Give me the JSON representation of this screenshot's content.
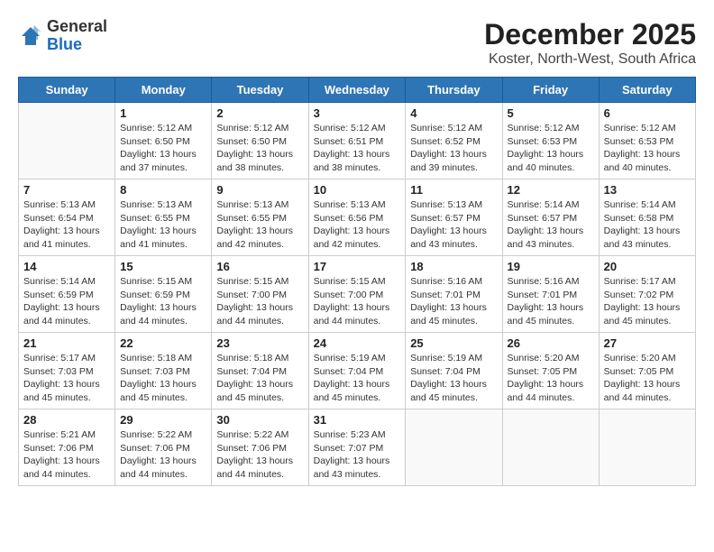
{
  "header": {
    "logo_general": "General",
    "logo_blue": "Blue",
    "title": "December 2025",
    "subtitle": "Koster, North-West, South Africa"
  },
  "days_of_week": [
    "Sunday",
    "Monday",
    "Tuesday",
    "Wednesday",
    "Thursday",
    "Friday",
    "Saturday"
  ],
  "weeks": [
    [
      {
        "day": "",
        "info": ""
      },
      {
        "day": "1",
        "info": "Sunrise: 5:12 AM\nSunset: 6:50 PM\nDaylight: 13 hours\nand 37 minutes."
      },
      {
        "day": "2",
        "info": "Sunrise: 5:12 AM\nSunset: 6:50 PM\nDaylight: 13 hours\nand 38 minutes."
      },
      {
        "day": "3",
        "info": "Sunrise: 5:12 AM\nSunset: 6:51 PM\nDaylight: 13 hours\nand 38 minutes."
      },
      {
        "day": "4",
        "info": "Sunrise: 5:12 AM\nSunset: 6:52 PM\nDaylight: 13 hours\nand 39 minutes."
      },
      {
        "day": "5",
        "info": "Sunrise: 5:12 AM\nSunset: 6:53 PM\nDaylight: 13 hours\nand 40 minutes."
      },
      {
        "day": "6",
        "info": "Sunrise: 5:12 AM\nSunset: 6:53 PM\nDaylight: 13 hours\nand 40 minutes."
      }
    ],
    [
      {
        "day": "7",
        "info": "Sunrise: 5:13 AM\nSunset: 6:54 PM\nDaylight: 13 hours\nand 41 minutes."
      },
      {
        "day": "8",
        "info": "Sunrise: 5:13 AM\nSunset: 6:55 PM\nDaylight: 13 hours\nand 41 minutes."
      },
      {
        "day": "9",
        "info": "Sunrise: 5:13 AM\nSunset: 6:55 PM\nDaylight: 13 hours\nand 42 minutes."
      },
      {
        "day": "10",
        "info": "Sunrise: 5:13 AM\nSunset: 6:56 PM\nDaylight: 13 hours\nand 42 minutes."
      },
      {
        "day": "11",
        "info": "Sunrise: 5:13 AM\nSunset: 6:57 PM\nDaylight: 13 hours\nand 43 minutes."
      },
      {
        "day": "12",
        "info": "Sunrise: 5:14 AM\nSunset: 6:57 PM\nDaylight: 13 hours\nand 43 minutes."
      },
      {
        "day": "13",
        "info": "Sunrise: 5:14 AM\nSunset: 6:58 PM\nDaylight: 13 hours\nand 43 minutes."
      }
    ],
    [
      {
        "day": "14",
        "info": "Sunrise: 5:14 AM\nSunset: 6:59 PM\nDaylight: 13 hours\nand 44 minutes."
      },
      {
        "day": "15",
        "info": "Sunrise: 5:15 AM\nSunset: 6:59 PM\nDaylight: 13 hours\nand 44 minutes."
      },
      {
        "day": "16",
        "info": "Sunrise: 5:15 AM\nSunset: 7:00 PM\nDaylight: 13 hours\nand 44 minutes."
      },
      {
        "day": "17",
        "info": "Sunrise: 5:15 AM\nSunset: 7:00 PM\nDaylight: 13 hours\nand 44 minutes."
      },
      {
        "day": "18",
        "info": "Sunrise: 5:16 AM\nSunset: 7:01 PM\nDaylight: 13 hours\nand 45 minutes."
      },
      {
        "day": "19",
        "info": "Sunrise: 5:16 AM\nSunset: 7:01 PM\nDaylight: 13 hours\nand 45 minutes."
      },
      {
        "day": "20",
        "info": "Sunrise: 5:17 AM\nSunset: 7:02 PM\nDaylight: 13 hours\nand 45 minutes."
      }
    ],
    [
      {
        "day": "21",
        "info": "Sunrise: 5:17 AM\nSunset: 7:03 PM\nDaylight: 13 hours\nand 45 minutes."
      },
      {
        "day": "22",
        "info": "Sunrise: 5:18 AM\nSunset: 7:03 PM\nDaylight: 13 hours\nand 45 minutes."
      },
      {
        "day": "23",
        "info": "Sunrise: 5:18 AM\nSunset: 7:04 PM\nDaylight: 13 hours\nand 45 minutes."
      },
      {
        "day": "24",
        "info": "Sunrise: 5:19 AM\nSunset: 7:04 PM\nDaylight: 13 hours\nand 45 minutes."
      },
      {
        "day": "25",
        "info": "Sunrise: 5:19 AM\nSunset: 7:04 PM\nDaylight: 13 hours\nand 45 minutes."
      },
      {
        "day": "26",
        "info": "Sunrise: 5:20 AM\nSunset: 7:05 PM\nDaylight: 13 hours\nand 44 minutes."
      },
      {
        "day": "27",
        "info": "Sunrise: 5:20 AM\nSunset: 7:05 PM\nDaylight: 13 hours\nand 44 minutes."
      }
    ],
    [
      {
        "day": "28",
        "info": "Sunrise: 5:21 AM\nSunset: 7:06 PM\nDaylight: 13 hours\nand 44 minutes."
      },
      {
        "day": "29",
        "info": "Sunrise: 5:22 AM\nSunset: 7:06 PM\nDaylight: 13 hours\nand 44 minutes."
      },
      {
        "day": "30",
        "info": "Sunrise: 5:22 AM\nSunset: 7:06 PM\nDaylight: 13 hours\nand 44 minutes."
      },
      {
        "day": "31",
        "info": "Sunrise: 5:23 AM\nSunset: 7:07 PM\nDaylight: 13 hours\nand 43 minutes."
      },
      {
        "day": "",
        "info": ""
      },
      {
        "day": "",
        "info": ""
      },
      {
        "day": "",
        "info": ""
      }
    ]
  ]
}
